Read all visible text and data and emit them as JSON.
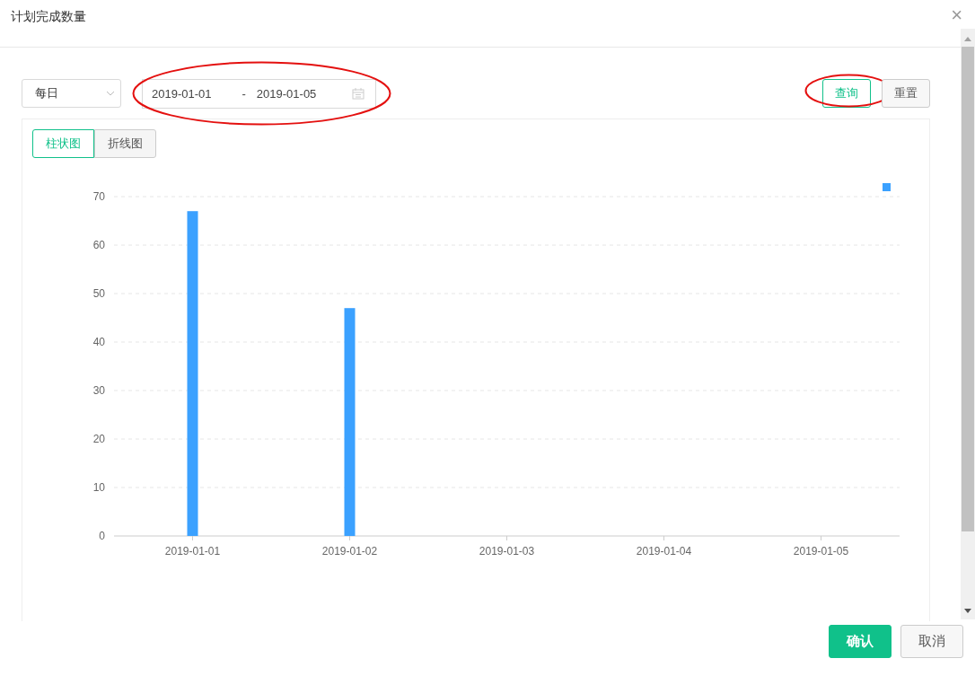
{
  "dialog": {
    "title": "计划完成数量",
    "close": "×"
  },
  "filters": {
    "period": {
      "value": "每日"
    },
    "date_range": {
      "start": "2019-01-01",
      "separator": "-",
      "end": "2019-01-05"
    }
  },
  "actions": [
    {
      "label": "查询",
      "kind": "outline"
    },
    {
      "label": "重置",
      "kind": "default"
    }
  ],
  "chart_tabs": [
    {
      "label": "柱状图",
      "selected": true
    },
    {
      "label": "折线图",
      "selected": false
    }
  ],
  "chart_data": {
    "type": "bar",
    "categories": [
      "2019-01-01",
      "2019-01-02",
      "2019-01-03",
      "2019-01-04",
      "2019-01-05"
    ],
    "series": [
      {
        "color": "#3ba1ff",
        "values": [
          67,
          47,
          0,
          0,
          0
        ]
      }
    ],
    "ylim": [
      0,
      70
    ],
    "grid": true,
    "yticks": [
      0,
      10,
      20,
      30,
      40,
      50,
      60,
      70
    ]
  },
  "footer_buttons": [
    {
      "label": "确认",
      "kind": "primary"
    },
    {
      "label": "取消",
      "kind": "default"
    }
  ]
}
